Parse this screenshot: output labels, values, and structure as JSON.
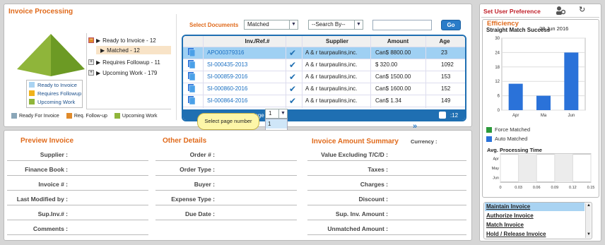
{
  "invoice_processing": {
    "title": "Invoice Processing",
    "tree": [
      {
        "label": "Ready to Invoice - 12"
      },
      {
        "label": "Matched - 12"
      },
      {
        "label": "Requires Followup - 11"
      },
      {
        "label": "Upcoming Work - 179"
      }
    ],
    "pyramid_legend": [
      "Ready to Invoice",
      "Requires Followup",
      "Upcoming Work"
    ],
    "bottom_legend": [
      "Ready For Invoice",
      "Req. Follow-up",
      "Upcoming Work"
    ],
    "colors": {
      "ready": "#7dbde8",
      "followup": "#f0b21b",
      "upcoming": "#8fb53a",
      "ready_sq": "#8aa6b8",
      "followup_sq": "#e08a2a"
    }
  },
  "documents": {
    "label": "Select Documents",
    "filter_value": "Matched",
    "search_by": "--Search By--",
    "search_value": "",
    "go": "Go",
    "columns": [
      "Inv./Ref.#",
      "Supplier",
      "Amount",
      "Age"
    ],
    "rows": [
      {
        "ref": "APO00379316",
        "supplier": "A & r taurpaulins,inc.",
        "amount": "Can$ 8800.00",
        "age": "23"
      },
      {
        "ref": "SI-000435-2013",
        "supplier": "A & r taurpaulins,inc.",
        "amount": "$ 320.00",
        "age": "1092"
      },
      {
        "ref": "SI-000859-2016",
        "supplier": "A & r taurpaulins,inc.",
        "amount": "Can$ 1500.00",
        "age": "153"
      },
      {
        "ref": "SI-000860-2016",
        "supplier": "A & r taurpaulins,inc.",
        "amount": "Can$ 1600.00",
        "age": "152"
      },
      {
        "ref": "SI-000864-2016",
        "supplier": "A & r taurpaulins,inc.",
        "amount": "Can$ 1.34",
        "age": "149"
      }
    ],
    "page_label": "Page",
    "page_value": "1",
    "page_options": [
      "1",
      "2",
      "3"
    ],
    "count": ":12",
    "tooltip": "Select page number"
  },
  "preview": {
    "title": "Preview Invoice",
    "fields": [
      "Supplier :",
      "Finance Book :",
      "Invoice # :",
      "Last Modified by :",
      "Sup.Inv.# :",
      "Comments :"
    ]
  },
  "other": {
    "title": "Other Details",
    "fields": [
      "Order # :",
      "Order Type :",
      "Buyer :",
      "Expense Type :",
      "Due Date :"
    ]
  },
  "summary": {
    "title": "Invoice Amount Summary",
    "currency": "Currency :",
    "fields": [
      "Value Excluding T/C/D :",
      "Taxes :",
      "Charges :",
      "Discount :",
      "Sup. Inv. Amount :",
      "Unmatched Amount :"
    ]
  },
  "right": {
    "title": "Set User Preference",
    "efficiency": "Efficiency",
    "chart_title": "Straight Match Success",
    "date": "28 Jun 2016",
    "legend_force": "Force Matched",
    "legend_auto": "Auto Matched",
    "avg_title": "Avg. Processing Time",
    "menu": [
      "Maintain Invoice",
      "Authorize Invoice",
      "Match Invoice",
      "Hold / Release Invoice"
    ]
  },
  "chart_data": [
    {
      "type": "bar",
      "title": "Straight Match Success",
      "categories": [
        "Apr",
        "Ma",
        "Jun"
      ],
      "values": [
        11,
        6,
        24
      ],
      "ylim": [
        0,
        30
      ],
      "yticks": [
        "0",
        "6",
        "12",
        "18",
        "24",
        "30"
      ],
      "xlabel": "",
      "ylabel": "",
      "colors": {
        "bar": "#2a72d9",
        "force": "#2b9a3b"
      }
    },
    {
      "type": "bar",
      "title": "Avg. Processing Time",
      "categories": [
        "Apr",
        "May",
        "Jun"
      ],
      "values": [
        0,
        0,
        0
      ],
      "xticks": [
        "0",
        "0.03",
        "0.06",
        "0.09",
        "0.12",
        "0.15"
      ],
      "xlim": [
        0,
        0.15
      ]
    }
  ]
}
